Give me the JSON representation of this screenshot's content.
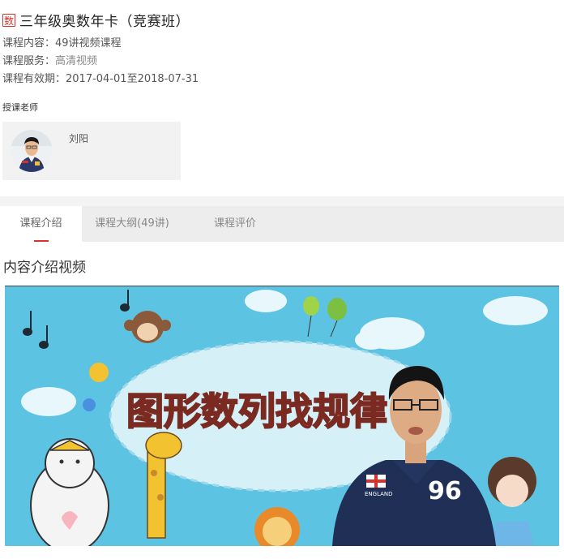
{
  "course": {
    "badge": "数",
    "title": "三年级奥数年卡（竞赛班）",
    "content_label": "课程内容：",
    "content_value": "49讲视频课程",
    "service_label": "课程服务：",
    "service_value": "高清视频",
    "validity_label": "课程有效期：",
    "validity_value": "2017-04-01至2018-07-31"
  },
  "teacher": {
    "section_label": "授课老师",
    "name": "刘阳"
  },
  "tabs": [
    {
      "label": "课程介绍",
      "active": true
    },
    {
      "label": "课程大纲(49讲)",
      "active": false
    },
    {
      "label": "课程评价",
      "active": false
    }
  ],
  "intro": {
    "title": "内容介绍视频",
    "video_banner_text": "图形数列找规律",
    "shirt_text": "ENGLAND",
    "shirt_number": "96"
  },
  "colors": {
    "accent": "#d9342b",
    "video_bg": "#5cc3e3",
    "tab_bar": "#ededed",
    "card_bg": "#f2f2f2"
  }
}
